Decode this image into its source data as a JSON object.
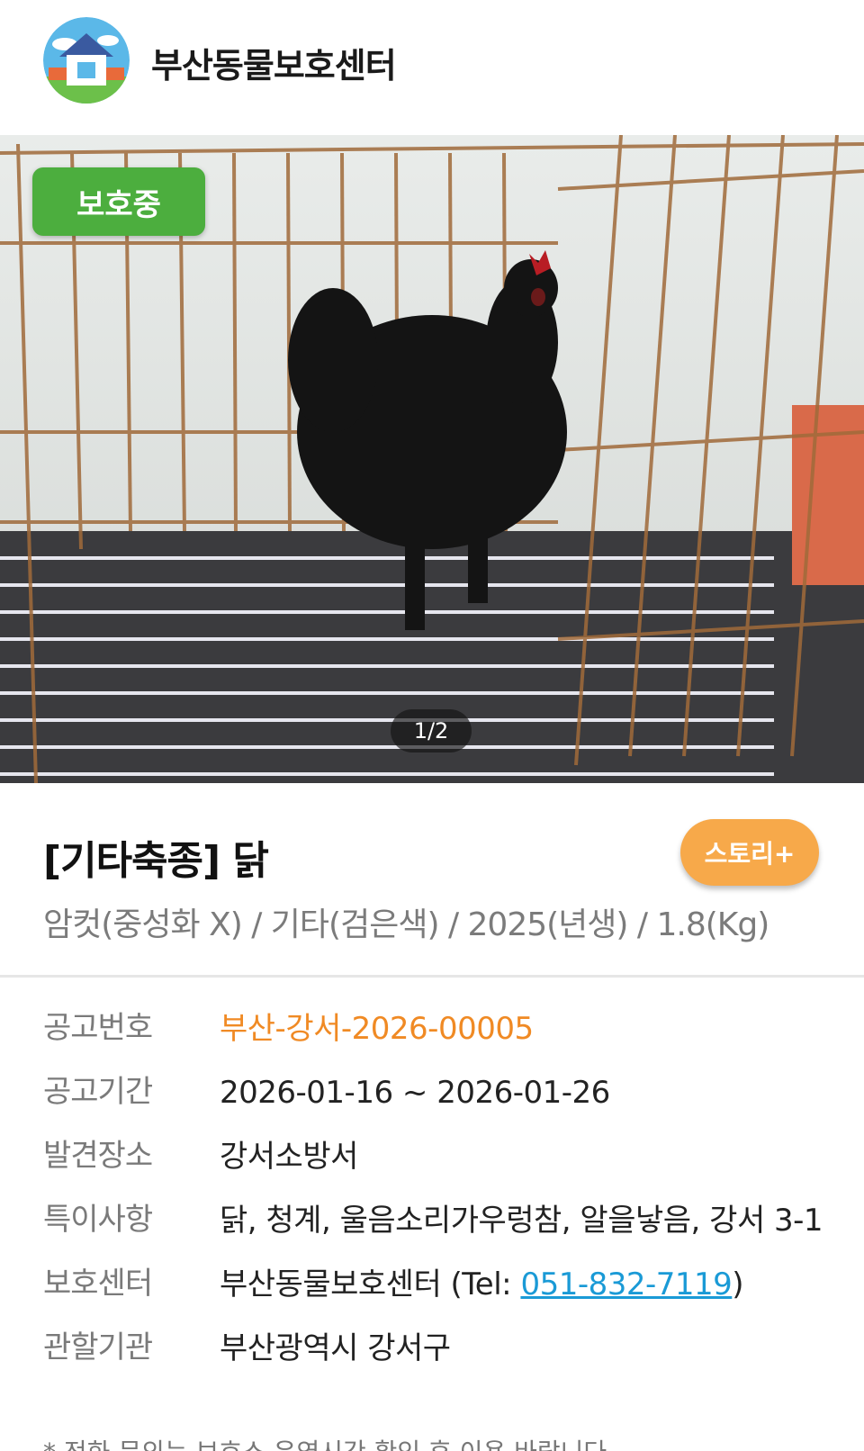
{
  "header": {
    "shelter_name": "부산동물보호센터",
    "logo_icon": "shelter-house-logo"
  },
  "photo": {
    "status_badge": "보호중",
    "pager": "1/2",
    "colors": {
      "badge": "#4cae3e"
    }
  },
  "animal": {
    "title": "[기타축종] 닭",
    "subtitle": "암컷(중성화 X) / 기타(검은색) / 2025(년생) / 1.8(Kg)",
    "story_button": "스토리+"
  },
  "info": {
    "rows": [
      {
        "label": "공고번호",
        "value": "부산-강서-2026-00005"
      },
      {
        "label": "공고기간",
        "value": "2026-01-16 ~ 2026-01-26"
      },
      {
        "label": "발견장소",
        "value": "강서소방서"
      },
      {
        "label": "특이사항",
        "value": "닭, 청계, 울음소리가우렁참, 알을낳음, 강서 3-1"
      },
      {
        "label": "보호센터",
        "value_prefix": "부산동물보호센터 (Tel: ",
        "tel": "051-832-7119",
        "value_suffix": ")"
      },
      {
        "label": "관할기관",
        "value": "부산광역시 강서구"
      }
    ],
    "footnote": "* 전화 문의는 보호소 운영시간 확인 후 이용 바랍니다."
  },
  "colors": {
    "accent_orange": "#f08a24",
    "story_button": "#f7a94a",
    "link": "#1a9ad6"
  }
}
